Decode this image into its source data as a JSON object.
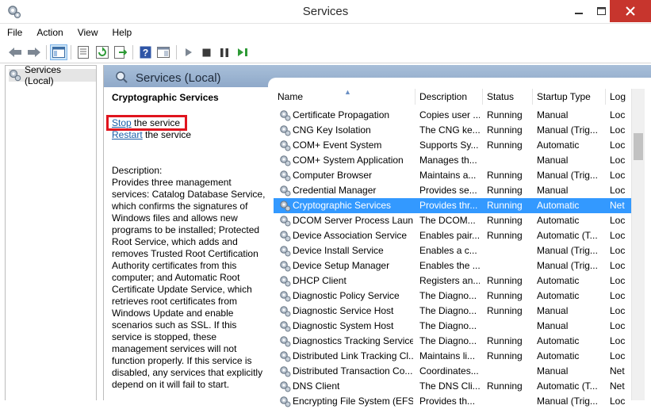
{
  "window": {
    "title": "Services"
  },
  "menu": [
    "File",
    "Action",
    "View",
    "Help"
  ],
  "tree": {
    "root_label": "Services (Local)"
  },
  "header": {
    "title": "Services (Local)"
  },
  "details": {
    "service_name": "Cryptographic Services",
    "stop_link": "Stop",
    "stop_suffix": " the service",
    "restart_link": "Restart",
    "restart_suffix": " the service",
    "description_label": "Description:",
    "description": "Provides three management services: Catalog Database Service, which confirms the signatures of Windows files and allows new programs to be installed; Protected Root Service, which adds and removes Trusted Root Certification Authority certificates from this computer; and Automatic Root Certificate Update Service, which retrieves root certificates from Windows Update and enable scenarios such as SSL. If this service is stopped, these management services will not function properly. If this service is disabled, any services that explicitly depend on it will fail to start."
  },
  "columns": [
    "Name",
    "Description",
    "Status",
    "Startup Type",
    "Log"
  ],
  "services": [
    {
      "name": "Certificate Propagation",
      "description": "Copies user ...",
      "status": "Running",
      "startup": "Manual",
      "logon": "Loc"
    },
    {
      "name": "CNG Key Isolation",
      "description": "The CNG ke...",
      "status": "Running",
      "startup": "Manual (Trig...",
      "logon": "Loc"
    },
    {
      "name": "COM+ Event System",
      "description": "Supports Sy...",
      "status": "Running",
      "startup": "Automatic",
      "logon": "Loc"
    },
    {
      "name": "COM+ System Application",
      "description": "Manages th...",
      "status": "",
      "startup": "Manual",
      "logon": "Loc"
    },
    {
      "name": "Computer Browser",
      "description": "Maintains a...",
      "status": "Running",
      "startup": "Manual (Trig...",
      "logon": "Loc"
    },
    {
      "name": "Credential Manager",
      "description": "Provides se...",
      "status": "Running",
      "startup": "Manual",
      "logon": "Loc"
    },
    {
      "name": "Cryptographic Services",
      "description": "Provides thr...",
      "status": "Running",
      "startup": "Automatic",
      "logon": "Net",
      "selected": true
    },
    {
      "name": "DCOM Server Process Laun...",
      "description": "The DCOM...",
      "status": "Running",
      "startup": "Automatic",
      "logon": "Loc"
    },
    {
      "name": "Device Association Service",
      "description": "Enables pair...",
      "status": "Running",
      "startup": "Automatic (T...",
      "logon": "Loc"
    },
    {
      "name": "Device Install Service",
      "description": "Enables a c...",
      "status": "",
      "startup": "Manual (Trig...",
      "logon": "Loc"
    },
    {
      "name": "Device Setup Manager",
      "description": "Enables the ...",
      "status": "",
      "startup": "Manual (Trig...",
      "logon": "Loc"
    },
    {
      "name": "DHCP Client",
      "description": "Registers an...",
      "status": "Running",
      "startup": "Automatic",
      "logon": "Loc"
    },
    {
      "name": "Diagnostic Policy Service",
      "description": "The Diagno...",
      "status": "Running",
      "startup": "Automatic",
      "logon": "Loc"
    },
    {
      "name": "Diagnostic Service Host",
      "description": "The Diagno...",
      "status": "Running",
      "startup": "Manual",
      "logon": "Loc"
    },
    {
      "name": "Diagnostic System Host",
      "description": "The Diagno...",
      "status": "",
      "startup": "Manual",
      "logon": "Loc"
    },
    {
      "name": "Diagnostics Tracking Service",
      "description": "The Diagno...",
      "status": "Running",
      "startup": "Automatic",
      "logon": "Loc"
    },
    {
      "name": "Distributed Link Tracking Cl...",
      "description": "Maintains li...",
      "status": "Running",
      "startup": "Automatic",
      "logon": "Loc"
    },
    {
      "name": "Distributed Transaction Co...",
      "description": "Coordinates...",
      "status": "",
      "startup": "Manual",
      "logon": "Net"
    },
    {
      "name": "DNS Client",
      "description": "The DNS Cli...",
      "status": "Running",
      "startup": "Automatic (T...",
      "logon": "Net"
    },
    {
      "name": "Encrypting File System (EFS)",
      "description": "Provides th...",
      "status": "",
      "startup": "Manual (Trig...",
      "logon": "Loc"
    }
  ],
  "icons": {
    "app": "services-gear-icon",
    "toolbar": [
      "back-arrow-icon",
      "forward-arrow-icon",
      "show-hide-tree-icon",
      "properties-icon",
      "refresh-icon",
      "export-list-icon",
      "help-icon",
      "console-icon",
      "start-service-icon",
      "stop-service-icon",
      "pause-service-icon",
      "restart-service-icon"
    ]
  },
  "colors": {
    "selection": "#3399ff",
    "header_strip": "#9ab3d2",
    "link": "#1a5ea8",
    "highlight_box": "#e0141e",
    "close_button": "#c7352d"
  }
}
